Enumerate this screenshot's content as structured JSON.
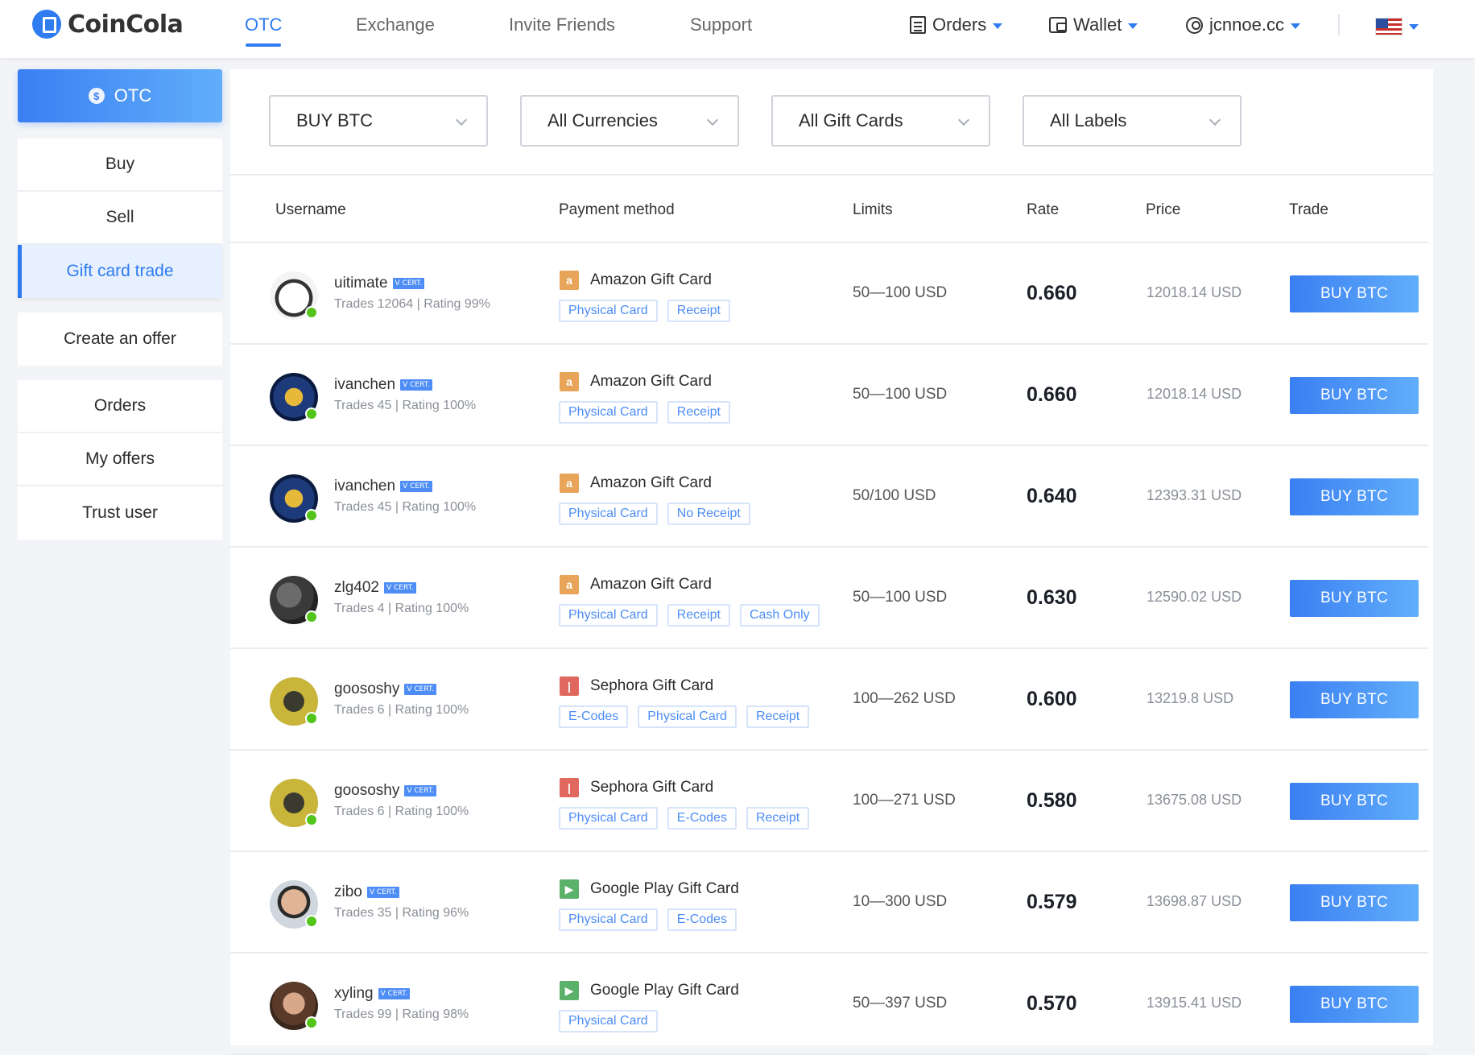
{
  "header": {
    "logo_text": "CoinCola",
    "nav": [
      "OTC",
      "Exchange",
      "Invite Friends",
      "Support"
    ],
    "orders_label": "Orders",
    "wallet_label": "Wallet",
    "username": "jcnnoe.cc",
    "accent_color": "#2f7bf0"
  },
  "sidebar": {
    "head": "OTC",
    "group1": [
      "Buy",
      "Sell",
      "Gift card trade"
    ],
    "group2": [
      "Create an offer"
    ],
    "group3": [
      "Orders",
      "My offers",
      "Trust user"
    ],
    "active": "Gift card trade"
  },
  "filters": {
    "trade": "BUY BTC",
    "currency": "All Currencies",
    "gift_card": "All Gift Cards",
    "labels": "All Labels"
  },
  "table": {
    "headers": [
      "Username",
      "Payment method",
      "Limits",
      "Rate",
      "Price",
      "Trade"
    ],
    "rows": [
      {
        "user": "uitimate",
        "cert": "V CERT.",
        "stats": "Trades 12064 | Rating 99%",
        "card": "Amazon Gift Card",
        "card_icon": "amazon-icon",
        "tags": [
          "Physical Card",
          "Receipt"
        ],
        "limits": "50—100 USD",
        "rate": "0.660",
        "price": "12018.14 USD",
        "button": "BUY BTC"
      },
      {
        "user": "ivanchen",
        "cert": "V CERT.",
        "stats": "Trades 45 | Rating 100%",
        "card": "Amazon Gift Card",
        "card_icon": "amazon-icon",
        "tags": [
          "Physical Card",
          "Receipt"
        ],
        "limits": "50—100 USD",
        "rate": "0.660",
        "price": "12018.14 USD",
        "button": "BUY BTC"
      },
      {
        "user": "ivanchen",
        "cert": "V CERT.",
        "stats": "Trades 45 | Rating 100%",
        "card": "Amazon Gift Card",
        "card_icon": "amazon-icon",
        "tags": [
          "Physical Card",
          "No Receipt"
        ],
        "limits": "50/100 USD",
        "rate": "0.640",
        "price": "12393.31 USD",
        "button": "BUY BTC"
      },
      {
        "user": "zlg402",
        "cert": "V CERT.",
        "stats": "Trades 4 | Rating 100%",
        "card": "Amazon Gift Card",
        "card_icon": "amazon-icon",
        "tags": [
          "Physical Card",
          "Receipt",
          "Cash Only"
        ],
        "limits": "50—100 USD",
        "rate": "0.630",
        "price": "12590.02 USD",
        "button": "BUY BTC"
      },
      {
        "user": "goososhy",
        "cert": "V CERT.",
        "stats": "Trades 6 | Rating 100%",
        "card": "Sephora Gift Card",
        "card_icon": "sephora-icon",
        "tags": [
          "E-Codes",
          "Physical Card",
          "Receipt"
        ],
        "limits": "100—262 USD",
        "rate": "0.600",
        "price": "13219.8 USD",
        "button": "BUY BTC"
      },
      {
        "user": "goososhy",
        "cert": "V CERT.",
        "stats": "Trades 6 | Rating 100%",
        "card": "Sephora Gift Card",
        "card_icon": "sephora-icon",
        "tags": [
          "Physical Card",
          "E-Codes",
          "Receipt"
        ],
        "limits": "100—271 USD",
        "rate": "0.580",
        "price": "13675.08 USD",
        "button": "BUY BTC"
      },
      {
        "user": "zibo",
        "cert": "V CERT.",
        "stats": "Trades 35 | Rating 96%",
        "card": "Google Play Gift Card",
        "card_icon": "google-play-icon",
        "tags": [
          "Physical Card",
          "E-Codes"
        ],
        "limits": "10—300 USD",
        "rate": "0.579",
        "price": "13698.87 USD",
        "button": "BUY BTC"
      },
      {
        "user": "xyling",
        "cert": "V CERT.",
        "stats": "Trades 99 | Rating 98%",
        "card": "Google Play Gift Card",
        "card_icon": "google-play-icon",
        "tags": [
          "Physical Card"
        ],
        "limits": "50—397 USD",
        "rate": "0.570",
        "price": "13915.41 USD",
        "button": "BUY BTC"
      }
    ]
  }
}
